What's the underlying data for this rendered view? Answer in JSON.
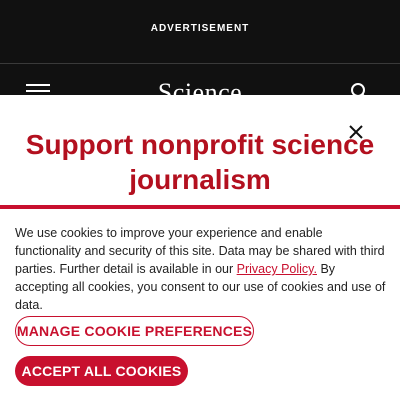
{
  "ad": {
    "label": "ADVERTISEMENT"
  },
  "header": {
    "logo_text": "Science"
  },
  "promo": {
    "headline": "Support nonprofit science journalism"
  },
  "consent": {
    "text_before_link": "We use cookies to improve your experience and enable functionality and security of this site. Data may be shared with third parties. Further detail is available in our ",
    "privacy_link": "Privacy Policy.",
    "text_after_link": " By accepting all cookies, you consent to our use of cookies and use of data."
  },
  "buttons": {
    "manage": "MANAGE COOKIE PREFERENCES",
    "accept": "ACCEPT ALL COOKIES"
  },
  "colors": {
    "brand_red": "#c8102e",
    "header_bg": "#111111"
  },
  "icons": [
    "menu-icon",
    "search-icon",
    "close-icon"
  ]
}
